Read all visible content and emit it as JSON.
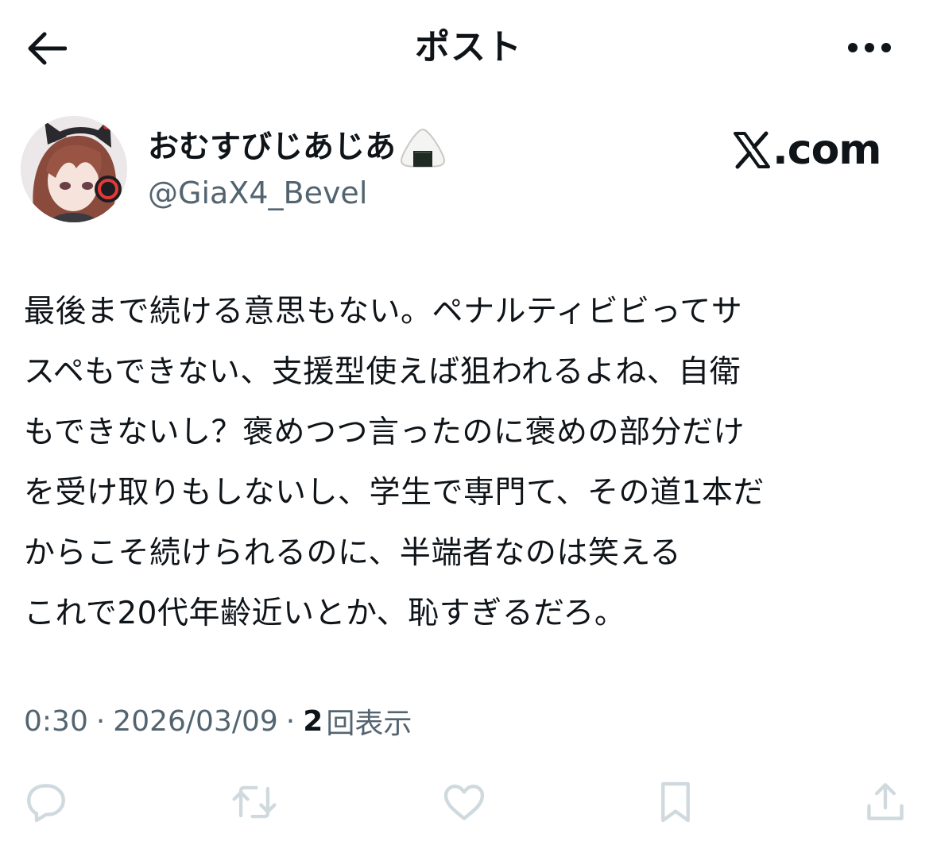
{
  "header": {
    "title": "ポスト"
  },
  "author": {
    "display_name": "おむすびじあじあ",
    "name_emoji": "onigiri-icon",
    "handle": "@GiaX4_Bevel"
  },
  "watermark": {
    "text": ".com"
  },
  "tweet": {
    "lines": [
      "最後まで続ける意思もない。ペナルティビビってサ",
      "スペもできない、支援型使えば狙われるよね、自衛",
      "もできないし？褒めつつ言ったのに褒めの部分だけ",
      "を受け取りもしないし、学生で専門て、その道1本だ",
      "からこそ続けられるのに、半端者なのは笑える",
      "これで20代年齢近いとか、恥すぎるだろ。"
    ]
  },
  "meta": {
    "time": "0:30",
    "separator": "·",
    "date": "2026/03/09",
    "views_count": "2",
    "views_label": "回表示"
  },
  "actions": {
    "items": [
      "reply-icon",
      "repost-icon",
      "like-icon",
      "bookmark-icon",
      "share-icon"
    ]
  },
  "colors": {
    "text_primary": "#0f1419",
    "text_secondary": "#536471",
    "icon_gray": "#cfd9de",
    "background": "#ffffff"
  }
}
